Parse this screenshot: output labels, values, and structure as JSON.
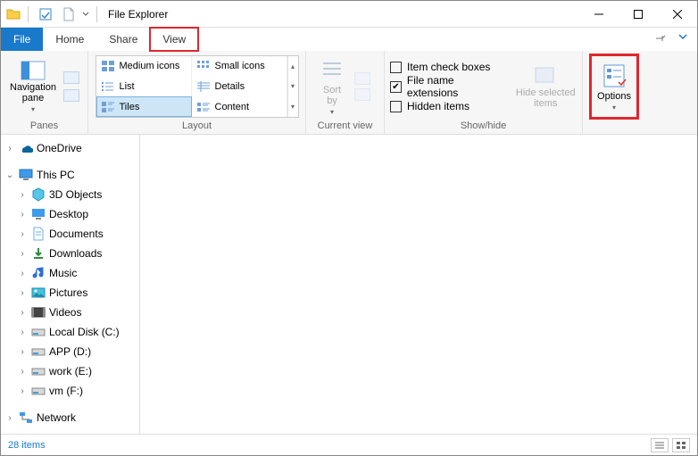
{
  "title": "File Explorer",
  "tabs": {
    "file": "File",
    "home": "Home",
    "share": "Share",
    "view": "View"
  },
  "ribbon": {
    "panes_label": "Panes",
    "nav_pane": "Navigation\npane",
    "layout_label": "Layout",
    "layout": {
      "medium": "Medium icons",
      "small": "Small icons",
      "list": "List",
      "details": "Details",
      "tiles": "Tiles",
      "content": "Content"
    },
    "currview_label": "Current view",
    "sort_by": "Sort\nby",
    "showhide_label": "Show/hide",
    "chk_itemboxes": "Item check boxes",
    "chk_ext": "File name extensions",
    "chk_hidden": "Hidden items",
    "hide_selected": "Hide selected\nitems",
    "options": "Options"
  },
  "tree": {
    "onedrive": "OneDrive",
    "thispc": "This PC",
    "objects3d": "3D Objects",
    "desktop": "Desktop",
    "documents": "Documents",
    "downloads": "Downloads",
    "music": "Music",
    "pictures": "Pictures",
    "videos": "Videos",
    "localc": "Local Disk (C:)",
    "appd": "APP (D:)",
    "worke": "work (E:)",
    "vmf": "vm (F:)",
    "network": "Network"
  },
  "status": {
    "items": "28 items"
  }
}
